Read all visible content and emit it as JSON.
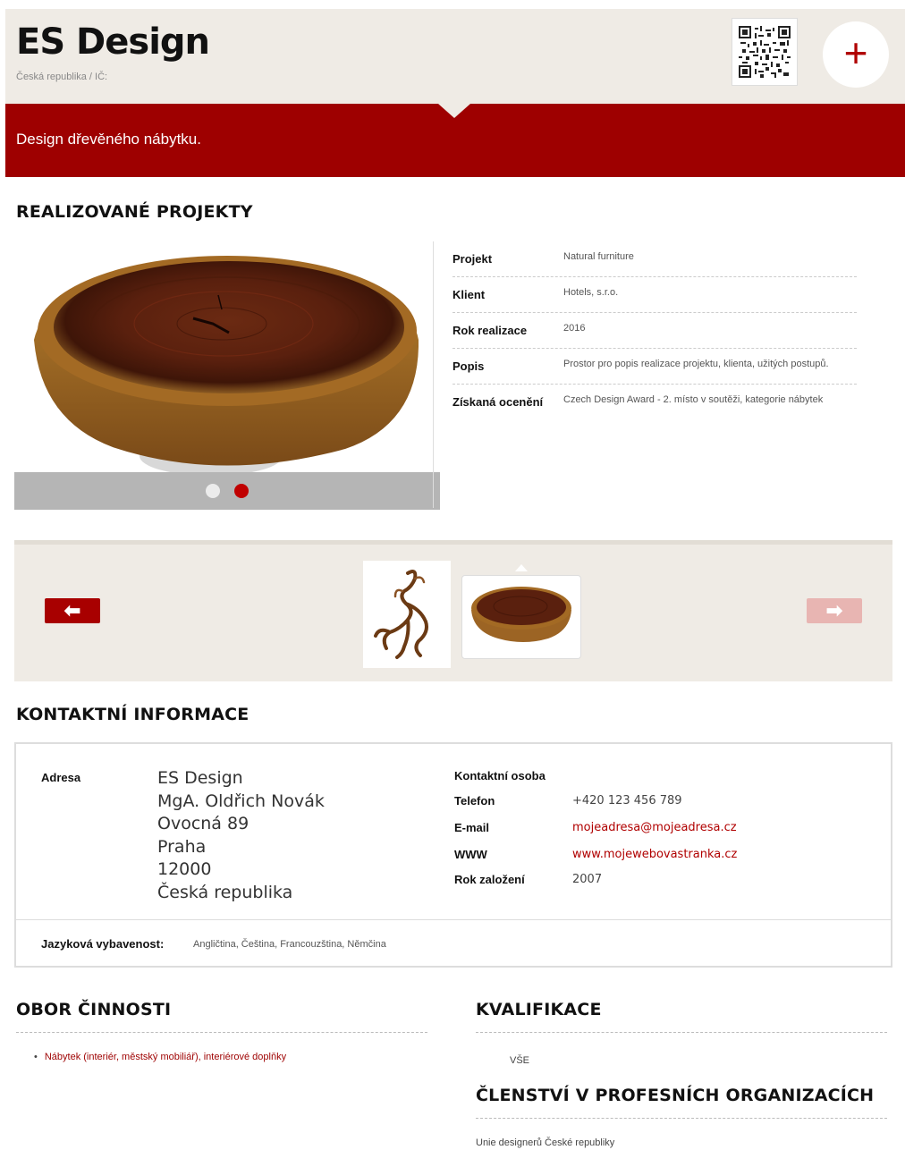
{
  "header": {
    "title": "ES Design",
    "subtitle": "Česká republika / IČ:",
    "qr_icon": "qr-code-icon",
    "plus_icon": "plus-icon",
    "plus_symbol": "+"
  },
  "banner": {
    "text": "Design dřevěného nábytku."
  },
  "projects": {
    "heading": "REALIZOVANÉ PROJEKTY",
    "slides_total": 2,
    "slide_active": 2,
    "rows": [
      {
        "label": "Projekt",
        "value": "Natural furniture"
      },
      {
        "label": "Klient",
        "value": "Hotels, s.r.o."
      },
      {
        "label": "Rok realizace",
        "value": "2016"
      },
      {
        "label": "Popis",
        "value": "Prostor pro popis realizace projektu, klienta, užitých postupů."
      },
      {
        "label": "Získaná ocenění",
        "value": "Czech Design Award - 2. místo v soutěži, kategorie nábytek"
      }
    ]
  },
  "thumbnails": {
    "prev_icon": "arrow-left-icon",
    "next_icon": "arrow-right-icon",
    "prev_symbol": "⬅",
    "next_symbol": "➡"
  },
  "contact": {
    "heading": "KONTAKTNÍ INFORMACE",
    "address_label": "Adresa",
    "address_lines": [
      "ES Design",
      "MgA. Oldřich Novák",
      "Ovocná 89",
      "Praha",
      "12000",
      "Česká republika"
    ],
    "contact_person_label": "Kontaktní osoba",
    "phone_label": "Telefon",
    "phone": "+420 123 456 789",
    "email_label": "E-mail",
    "email": "mojeadresa@mojeadresa.cz",
    "www_label": "WWW",
    "www": "www.mojewebovastranka.cz",
    "founded_label": "Rok založení",
    "founded": "2007",
    "languages_label": "Jazyková vybavenost:",
    "languages": "Angličtina, Čeština, Francouzština, Němčina"
  },
  "activity": {
    "heading": "OBOR ČINNOSTI",
    "items": [
      "Nábytek (interiér, městský mobiliář), interiérové doplňky"
    ]
  },
  "qualification": {
    "heading": "KVALIFIKACE",
    "value": "VŠE"
  },
  "membership": {
    "heading": "ČLENSTVÍ V PROFESNÍCH ORGANIZACÍCH",
    "value": "Unie designerů České republiky"
  },
  "colors": {
    "brand_red": "#9e0000",
    "header_bg": "#efebe5",
    "link_red": "#b00000"
  }
}
